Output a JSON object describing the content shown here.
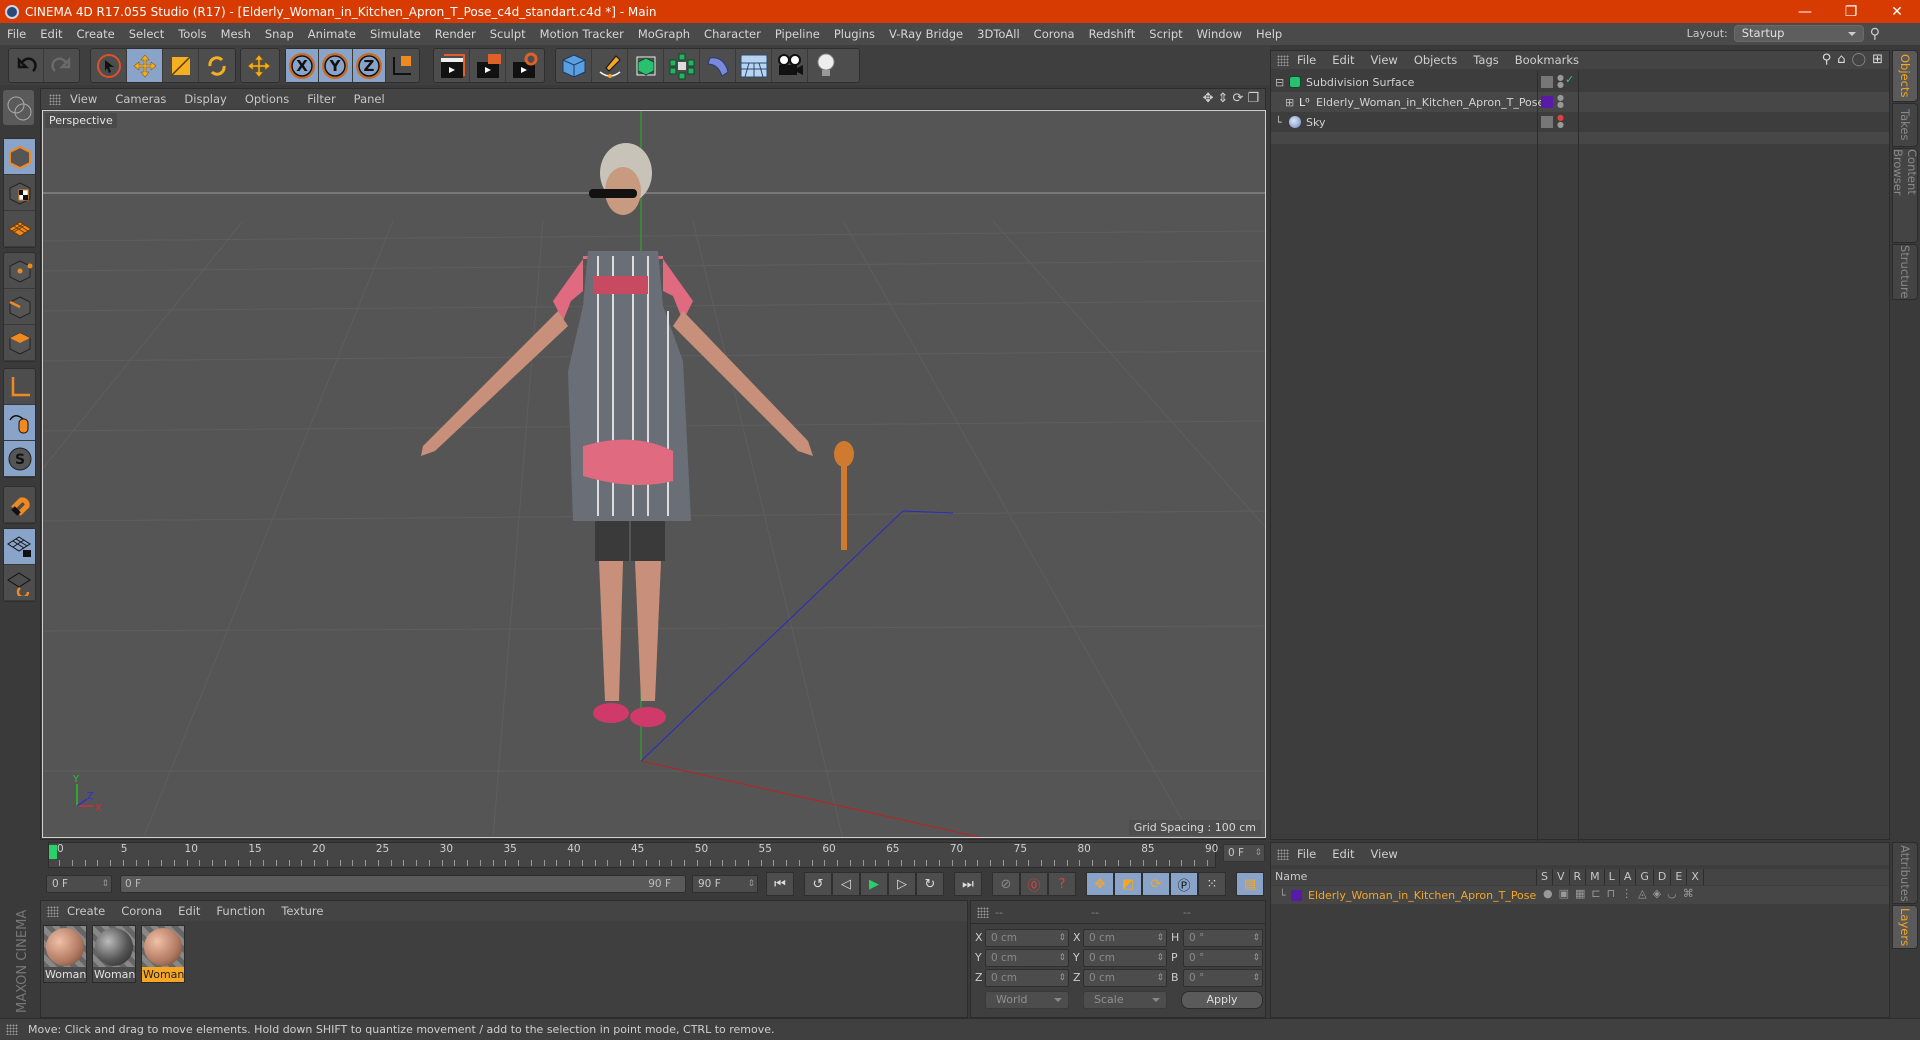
{
  "window": {
    "title": "CINEMA 4D R17.055 Studio (R17) - [Elderly_Woman_in_Kitchen_Apron_T_Pose_c4d_standart.c4d *] - Main",
    "controls": {
      "minimize": "—",
      "restore": "❐",
      "close": "✕"
    }
  },
  "menubar": {
    "items": [
      "File",
      "Edit",
      "Create",
      "Select",
      "Tools",
      "Mesh",
      "Snap",
      "Animate",
      "Simulate",
      "Render",
      "Sculpt",
      "Motion Tracker",
      "MoGraph",
      "Character",
      "Pipeline",
      "Plugins",
      "V-Ray Bridge",
      "3DToAll",
      "Corona",
      "Redshift",
      "Script",
      "Window",
      "Help"
    ],
    "layout_label": "Layout:",
    "layout_value": "Startup"
  },
  "toolbar": {
    "icons": [
      "undo-icon",
      "redo-icon",
      "select-live-icon",
      "move-icon",
      "scale-icon",
      "rotate-icon",
      "move-last-icon",
      "x-axis-icon",
      "y-axis-icon",
      "z-axis-icon",
      "coordinate-system-icon",
      "render-view-icon",
      "render-picture-viewer-icon",
      "render-settings-icon",
      "cube-primitive-icon",
      "pen-spline-icon",
      "subdivision-surface-icon",
      "cloner-icon",
      "deformer-bend-icon",
      "floor-environment-icon",
      "camera-icon",
      "light-icon"
    ],
    "axis_labels": [
      "X",
      "Y",
      "Z"
    ]
  },
  "left_tools": {
    "icons": [
      "make-editable-icon",
      "model-mode-icon",
      "texture-mode-icon",
      "workplane-mode-icon",
      "points-mode-icon",
      "edges-mode-icon",
      "polygons-mode-icon",
      "axis-mode-icon",
      "tweak-mode-icon",
      "solo-mode-icon",
      "snap-magnet-icon",
      "workplane-lock-icon",
      "workplane-align-icon"
    ],
    "solo_label": "S"
  },
  "viewport": {
    "menu": [
      "View",
      "Cameras",
      "Display",
      "Options",
      "Filter",
      "Panel"
    ],
    "label": "Perspective",
    "grid_spacing": "Grid Spacing : 100 cm",
    "nav_icons": [
      "pan-icon",
      "dolly-icon",
      "orbit-icon",
      "maximize-view-icon"
    ],
    "axis_gizmo": {
      "x": "X",
      "y": "Y",
      "z": "Z"
    }
  },
  "timeline": {
    "ticks": [
      0,
      5,
      10,
      15,
      20,
      25,
      30,
      35,
      40,
      45,
      50,
      55,
      60,
      65,
      70,
      75,
      80,
      85,
      90
    ],
    "current_frame": "0 F",
    "start_field": "0 F",
    "range_start": "0 F",
    "range_end": "90 F",
    "end_field": "90 F"
  },
  "transport": {
    "buttons": [
      "go-to-start-icon",
      "previous-key-icon",
      "previous-frame-icon",
      "play-icon",
      "next-frame-icon",
      "next-key-icon",
      "go-to-end-icon",
      "record-active-objects-icon",
      "autokeying-icon",
      "keyframe-selection-icon",
      "key-position-icon",
      "key-scale-icon",
      "key-rotation-icon",
      "key-parameter-icon",
      "key-point-level-icon",
      "timeline-window-icon"
    ]
  },
  "materials": {
    "menu": [
      "Create",
      "Corona",
      "Edit",
      "Function",
      "Texture"
    ],
    "items": [
      {
        "label": "Woman",
        "selected": false,
        "color": "#c48a6e"
      },
      {
        "label": "Woman",
        "selected": false,
        "color": "#6a6a6a"
      },
      {
        "label": "Woman",
        "selected": true,
        "color": "#c48a6e"
      }
    ],
    "brand": "MAXON CINEMA 4D"
  },
  "coordinates": {
    "headers": [
      "--",
      "--",
      "--"
    ],
    "rows": [
      {
        "l1": "X",
        "v1": "0 cm",
        "l2": "X",
        "v2": "0 cm",
        "l3": "H",
        "v3": "0 °"
      },
      {
        "l1": "Y",
        "v1": "0 cm",
        "l2": "Y",
        "v2": "0 cm",
        "l3": "P",
        "v3": "0 °"
      },
      {
        "l1": "Z",
        "v1": "0 cm",
        "l2": "Z",
        "v2": "0 cm",
        "l3": "B",
        "v3": "0 °"
      }
    ],
    "mode_world": "World",
    "mode_scale": "Scale",
    "apply": "Apply"
  },
  "object_manager": {
    "menu": [
      "File",
      "Edit",
      "View",
      "Objects",
      "Tags",
      "Bookmarks"
    ],
    "objects": [
      {
        "name": "Subdivision Surface",
        "icon": "subdivision-surface-icon",
        "expander": "⊟",
        "tag": "check"
      },
      {
        "name": "Elderly_Woman_in_Kitchen_Apron_T_Pose",
        "icon": "null-object-icon",
        "expander": "⊞",
        "tag": "layer-color",
        "layer_color": "#5a1aa8"
      },
      {
        "name": "Sky",
        "icon": "sky-icon",
        "expander": "",
        "tag": ""
      }
    ]
  },
  "layer_manager": {
    "menu": [
      "File",
      "Edit",
      "View"
    ],
    "columns": [
      "Name",
      "S",
      "V",
      "R",
      "M",
      "L",
      "A",
      "G",
      "D",
      "E",
      "X"
    ],
    "layers": [
      {
        "name": "Elderly_Woman_in_Kitchen_Apron_T_Pose",
        "color": "#5a1aa8"
      }
    ]
  },
  "side_tabs": {
    "top": [
      {
        "label": "Objects",
        "active": true
      },
      {
        "label": "Takes",
        "active": false
      },
      {
        "label": "Content Browser",
        "active": false
      },
      {
        "label": "Structure",
        "active": false
      }
    ],
    "bottom": [
      {
        "label": "Attributes",
        "active": false
      },
      {
        "label": "Layers",
        "active": true
      }
    ]
  },
  "status": {
    "text": "Move: Click and drag to move elements. Hold down SHIFT to quantize movement / add to the selection in point mode, CTRL to remove."
  },
  "colors": {
    "title_bar": "#d83b01",
    "accent_orange": "#f5a623",
    "active_tool_blue": "#8aa3c8"
  }
}
